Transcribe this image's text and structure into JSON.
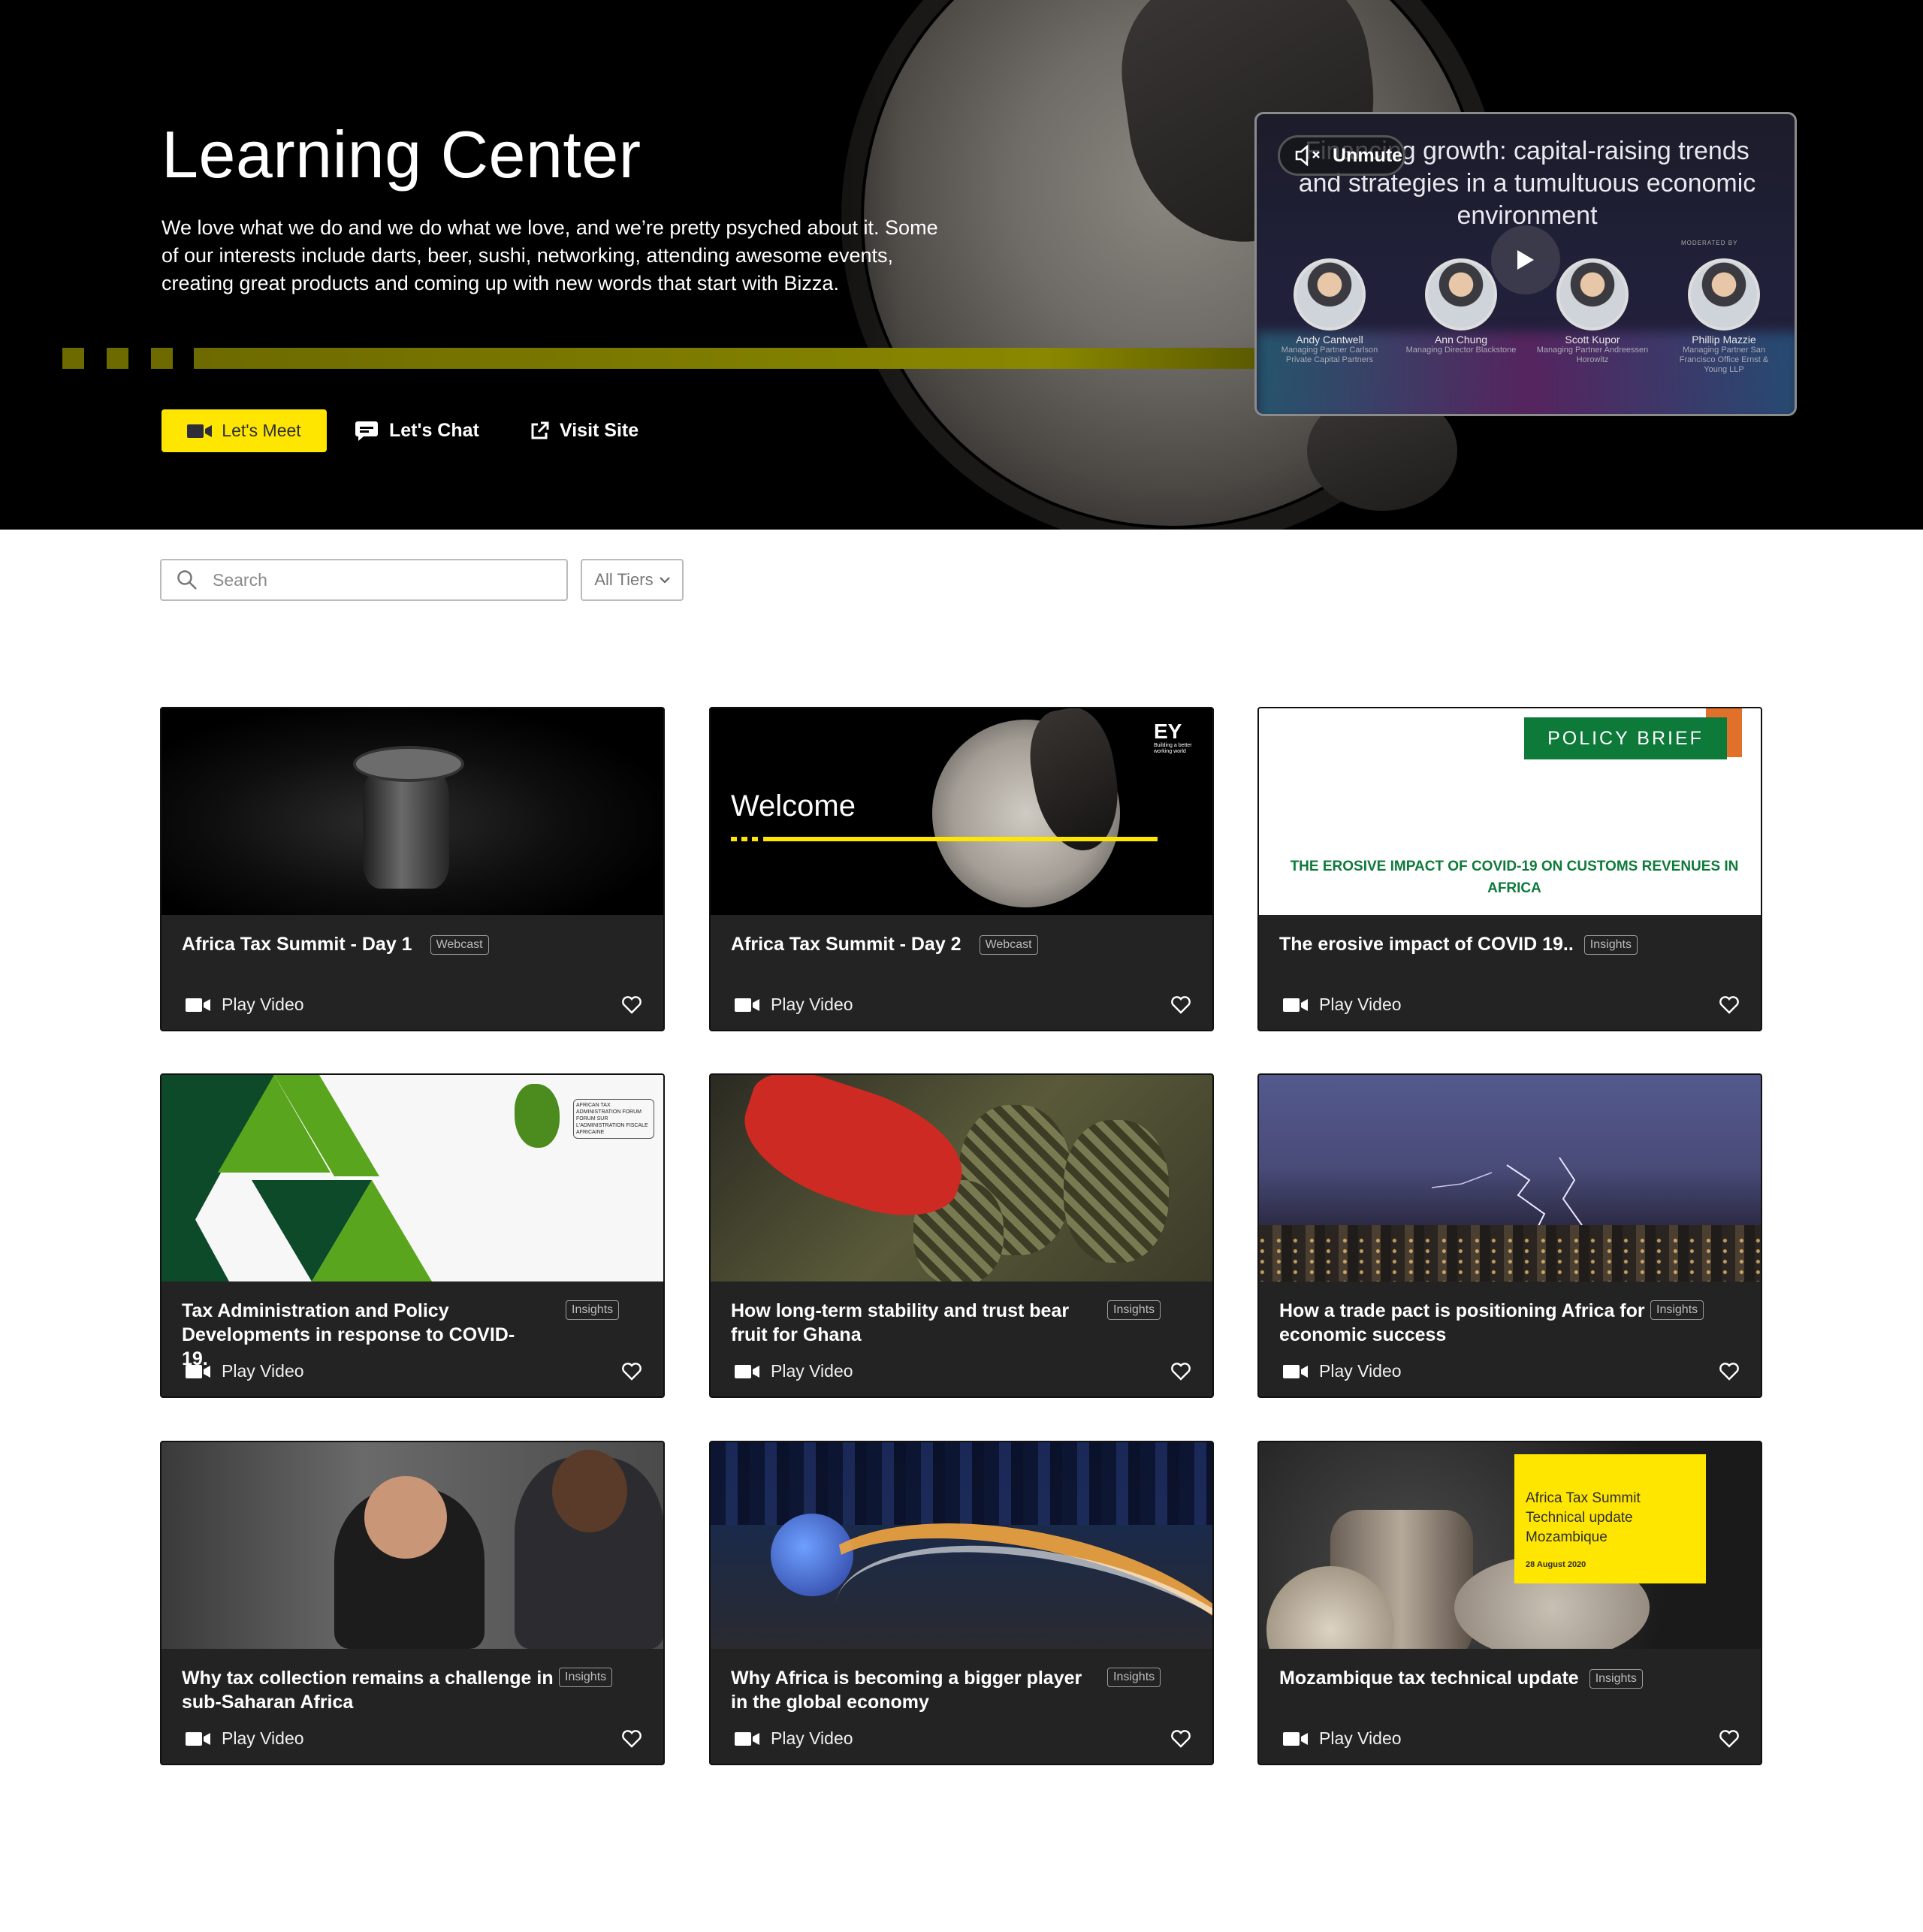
{
  "hero": {
    "title": "Learning Center",
    "description": "We love what we do and we do what we love, and we’re pretty psyched about it. Some of our interests include darts, beer, sushi, networking, attending awesome events, creating great products and coming up with new words that start with Bizza.",
    "buttons": {
      "meet": "Let's Meet",
      "chat": "Let's Chat",
      "visit": "Visit Site"
    },
    "accent_color": "#ffe600"
  },
  "preview": {
    "unmute_label": "Unmute",
    "title": "Financing growth: capital-raising trends and strategies in a tumultuous economic environment",
    "moderated_by": "MODERATED BY",
    "speakers": [
      {
        "name": "Andy Cantwell",
        "role": "Managing Partner Carlson Private Capital Partners"
      },
      {
        "name": "Ann Chung",
        "role": "Managing Director Blackstone"
      },
      {
        "name": "Scott Kupor",
        "role": "Managing Partner Andreessen Horowitz"
      },
      {
        "name": "Phillip Mazzie",
        "role": "Managing Partner San Francisco Office Ernst & Young LLP"
      }
    ]
  },
  "filters": {
    "search_placeholder": "Search",
    "tier_select": "All Tiers"
  },
  "cards": [
    {
      "title": "Africa Tax Summit - Day 1",
      "badge": "Webcast",
      "action": "Play Video"
    },
    {
      "title": "Africa Tax Summit - Day 2",
      "badge": "Webcast",
      "action": "Play Video",
      "thumb_text": "Welcome",
      "thumb_logo": "EY",
      "thumb_logo_sub": "Building a better working world"
    },
    {
      "title": "The erosive impact of COVID 19..",
      "badge": "Insights",
      "action": "Play Video",
      "thumb_tag": "POLICY BRIEF",
      "thumb_text": "THE EROSIVE IMPACT OF COVID-19 ON CUSTOMS REVENUES IN AFRICA"
    },
    {
      "title": "Tax Administration and Policy Developments in response to COVID-19.",
      "badge": "Insights",
      "action": "Play Video",
      "thumb_text": "AFRICAN TAX ADMINISTRATION FORUM FORUM SUR L'ADMINISTRATION FISCALE AFRICAINE"
    },
    {
      "title": "How long-term stability and trust bear fruit for Ghana",
      "badge": "Insights",
      "action": "Play Video"
    },
    {
      "title": "How a trade pact is positioning Africa for economic success",
      "badge": "Insights",
      "action": "Play Video"
    },
    {
      "title": "Why tax collection remains a challenge in sub-Saharan Africa",
      "badge": "Insights",
      "action": "Play Video"
    },
    {
      "title": "Why Africa is becoming a bigger player in the global economy",
      "badge": "Insights",
      "action": "Play Video"
    },
    {
      "title": "Mozambique tax technical update",
      "badge": "Insights",
      "action": "Play Video",
      "thumb_text": "Africa Tax Summit Technical update Mozambique",
      "thumb_date": "28 August 2020"
    }
  ],
  "colors": {
    "card_bg": "#232323",
    "badge_border": "#9b9b9b",
    "policy_green": "#0e7a3a"
  }
}
